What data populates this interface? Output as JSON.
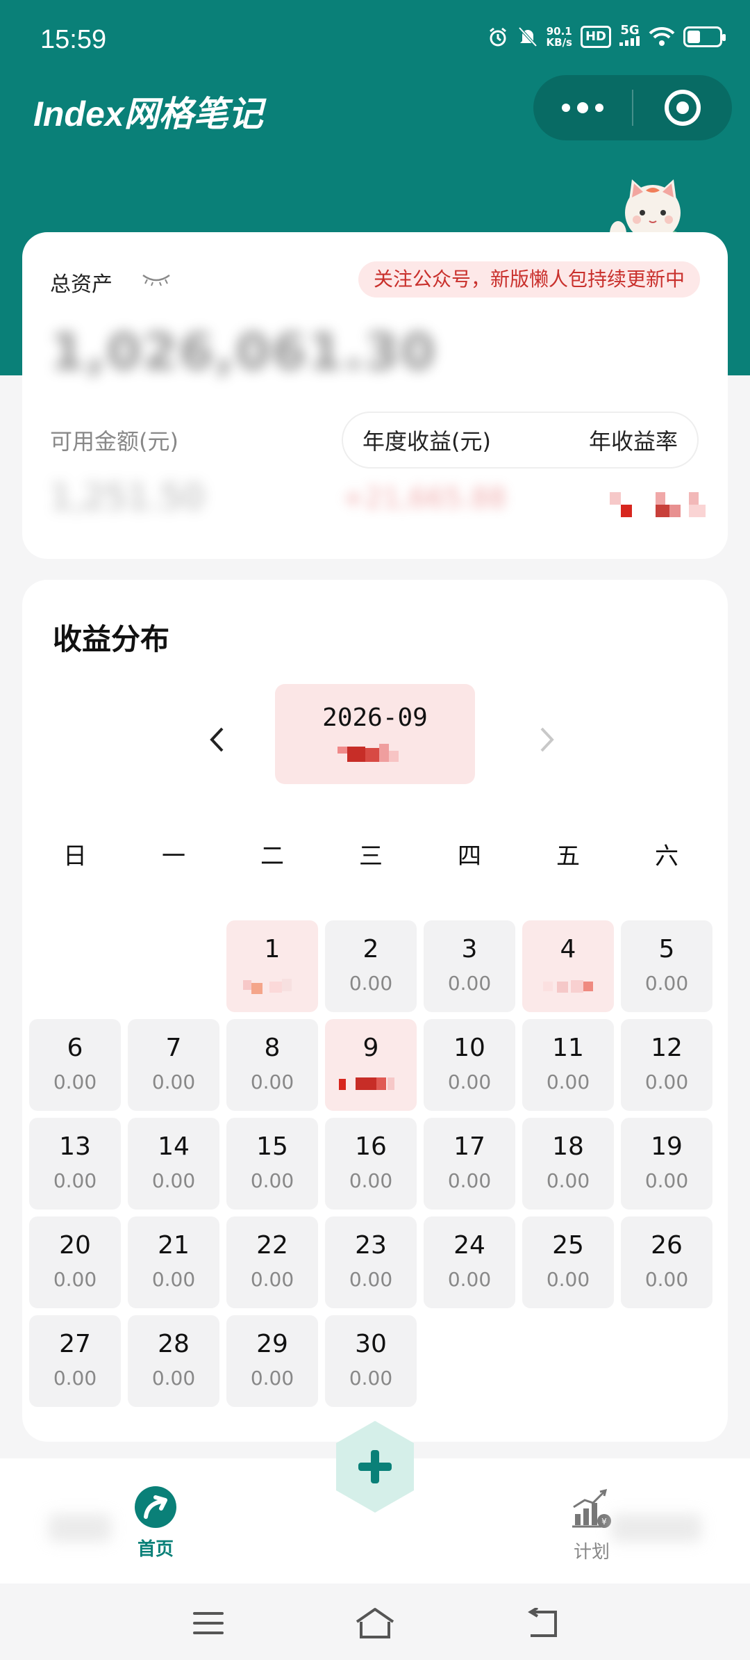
{
  "status_bar": {
    "time": "15:59",
    "net_speed_top": "90.1",
    "net_speed_unit": "KB/s",
    "hd": "HD",
    "network": "5G"
  },
  "header": {
    "title": "Index网格笔记",
    "brand_color": "#0a8078"
  },
  "assets": {
    "total_label": "总资产",
    "notice": "关注公众号，新版懒人包持续更新中",
    "total_value": "1,026,061.30",
    "available_label": "可用金额(元)",
    "available_value": "1,251.50",
    "toggle": {
      "annual_profit_label": "年度收益(元)",
      "annual_rate_label": "年收益率"
    },
    "annual_profit_value": "+21,665.88"
  },
  "calendar": {
    "title": "收益分布",
    "month": "2026-09",
    "weekdays": [
      "日",
      "一",
      "二",
      "三",
      "四",
      "五",
      "六"
    ],
    "first_weekday_index": 2,
    "days": [
      {
        "day": "1",
        "value": "",
        "highlight": true
      },
      {
        "day": "2",
        "value": "0.00",
        "highlight": false
      },
      {
        "day": "3",
        "value": "0.00",
        "highlight": false
      },
      {
        "day": "4",
        "value": "",
        "highlight": true
      },
      {
        "day": "5",
        "value": "0.00",
        "highlight": false
      },
      {
        "day": "6",
        "value": "0.00",
        "highlight": false
      },
      {
        "day": "7",
        "value": "0.00",
        "highlight": false
      },
      {
        "day": "8",
        "value": "0.00",
        "highlight": false
      },
      {
        "day": "9",
        "value": "",
        "highlight": true
      },
      {
        "day": "10",
        "value": "0.00",
        "highlight": false
      },
      {
        "day": "11",
        "value": "0.00",
        "highlight": false
      },
      {
        "day": "12",
        "value": "0.00",
        "highlight": false
      },
      {
        "day": "13",
        "value": "0.00",
        "highlight": false
      },
      {
        "day": "14",
        "value": "0.00",
        "highlight": false
      },
      {
        "day": "15",
        "value": "0.00",
        "highlight": false
      },
      {
        "day": "16",
        "value": "0.00",
        "highlight": false
      },
      {
        "day": "17",
        "value": "0.00",
        "highlight": false
      },
      {
        "day": "18",
        "value": "0.00",
        "highlight": false
      },
      {
        "day": "19",
        "value": "0.00",
        "highlight": false
      },
      {
        "day": "20",
        "value": "0.00",
        "highlight": false
      },
      {
        "day": "21",
        "value": "0.00",
        "highlight": false
      },
      {
        "day": "22",
        "value": "0.00",
        "highlight": false
      },
      {
        "day": "23",
        "value": "0.00",
        "highlight": false
      },
      {
        "day": "24",
        "value": "0.00",
        "highlight": false
      },
      {
        "day": "25",
        "value": "0.00",
        "highlight": false
      },
      {
        "day": "26",
        "value": "0.00",
        "highlight": false
      },
      {
        "day": "27",
        "value": "0.00",
        "highlight": false
      },
      {
        "day": "28",
        "value": "0.00",
        "highlight": false
      },
      {
        "day": "29",
        "value": "0.00",
        "highlight": false
      },
      {
        "day": "30",
        "value": "0.00",
        "highlight": false
      }
    ]
  },
  "tabbar": {
    "home_label": "首页",
    "plan_label": "计划",
    "add_icon": "plus-icon"
  },
  "nav": {
    "icons": [
      "menu-icon",
      "home-icon",
      "back-icon"
    ]
  }
}
